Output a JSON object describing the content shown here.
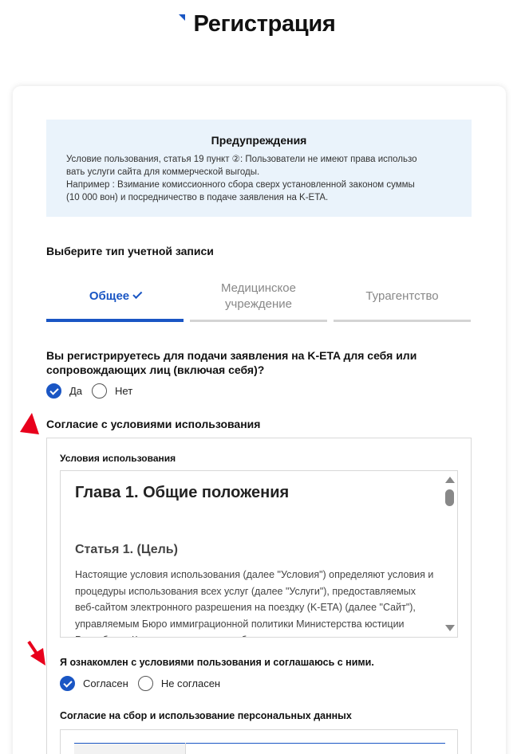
{
  "page": {
    "title": "Регистрация",
    "accent_color": "#1a56c4"
  },
  "warning": {
    "title": "Предупреждения",
    "text": "Условие пользования, статья 19 пункт ②: Пользователи не имеют права использо\nвать услуги сайта для коммерческой выгоды.\nНапример : Взимание комиссионного сбора сверх установленной законом суммы\n(10 000 вон) и посредничество в подаче заявления на K-ETA."
  },
  "account_type": {
    "label": "Выберите тип учетной записи",
    "tabs": [
      {
        "label": "Общее",
        "selected": true
      },
      {
        "label": "Медицинское учреждение",
        "selected": false
      },
      {
        "label": "Турагентство",
        "selected": false
      }
    ]
  },
  "self_registration": {
    "question": "Вы регистрируетесь для подачи заявления на K-ETA для себя или сопровождающих лиц (включая себя)?",
    "options": [
      {
        "label": "Да",
        "checked": true
      },
      {
        "label": "Нет",
        "checked": false
      }
    ]
  },
  "terms": {
    "section_label": "Согласие с условиями использования",
    "box_label": "Условия использования",
    "chapter": "Глава 1. Общие положения",
    "article": "Статья 1. (Цель)",
    "body": "Настоящие условия использования (далее \"Условия\") определяют условия и процедуры использования всех услуг (далее \"Услуги\"), предоставляемых веб-сайтом электронного разрешения на поездку (K-ETA) (далее \"Сайт\"), управляемым Бюро иммиграционной политики Министерства юстиции Республики Корея, а также права, обязанности"
  },
  "terms_consent": {
    "question": "Я ознакомлен с условиями пользования и соглашаюсь с ними.",
    "options": [
      {
        "label": "Согласен",
        "checked": true
      },
      {
        "label": "Не согласен",
        "checked": false
      }
    ]
  },
  "personal_data": {
    "label": "Согласие на сбор и использование персональных данных"
  },
  "annotation_color": "#e8001c"
}
